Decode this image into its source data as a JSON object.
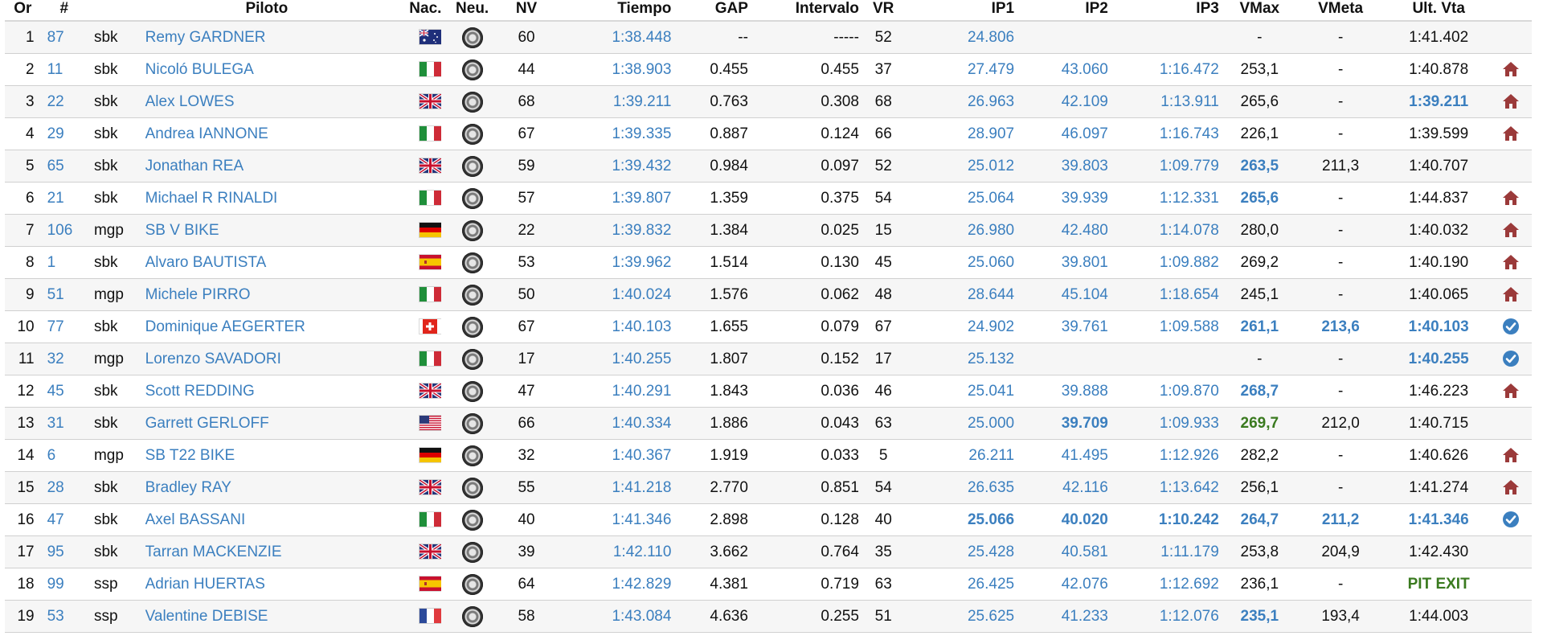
{
  "headers": {
    "pos": "Or",
    "num": "#",
    "rider": "Piloto",
    "nat": "Nac.",
    "tyre": "Neu.",
    "nv": "NV",
    "time": "Tiempo",
    "gap": "GAP",
    "interval": "Intervalo",
    "vr": "VR",
    "ip1": "IP1",
    "ip2": "IP2",
    "ip3": "IP3",
    "vmax": "VMax",
    "vmeta": "VMeta",
    "last": "Ult. Vta"
  },
  "colors": {
    "link": "#3b7fbf",
    "pit_icon": "#9b3a3a",
    "check_icon": "#3b7fbf",
    "green": "#3a7a1f"
  },
  "rows": [
    {
      "pos": "1",
      "num": "87",
      "cls": "sbk",
      "name": "Remy GARDNER",
      "flag": "AUS",
      "nv": "60",
      "time": "1:38.448",
      "gap": "--",
      "interval": "-----",
      "vr": "52",
      "ip1": "24.806",
      "ip2": "",
      "ip3": "",
      "vmax": "-",
      "vmeta": "-",
      "last": "1:41.402",
      "icon": ""
    },
    {
      "pos": "2",
      "num": "11",
      "cls": "sbk",
      "name": "Nicoló BULEGA",
      "flag": "ITA",
      "nv": "44",
      "time": "1:38.903",
      "gap": "0.455",
      "interval": "0.455",
      "vr": "37",
      "ip1": "27.479",
      "ip2": "43.060",
      "ip3": "1:16.472",
      "vmax": "253,1",
      "vmeta": "-",
      "last": "1:40.878",
      "icon": "pit"
    },
    {
      "pos": "3",
      "num": "22",
      "cls": "sbk",
      "name": "Alex LOWES",
      "flag": "GBR",
      "nv": "68",
      "time": "1:39.211",
      "gap": "0.763",
      "interval": "0.308",
      "vr": "68",
      "ip1": "26.963",
      "ip2": "42.109",
      "ip3": "1:13.911",
      "vmax": "265,6",
      "vmeta": "-",
      "last": "1:39.211",
      "icon": "pit",
      "last_style": "link-bold"
    },
    {
      "pos": "4",
      "num": "29",
      "cls": "sbk",
      "name": "Andrea IANNONE",
      "flag": "ITA",
      "nv": "67",
      "time": "1:39.335",
      "gap": "0.887",
      "interval": "0.124",
      "vr": "66",
      "ip1": "28.907",
      "ip2": "46.097",
      "ip3": "1:16.743",
      "vmax": "226,1",
      "vmeta": "-",
      "last": "1:39.599",
      "icon": "pit"
    },
    {
      "pos": "5",
      "num": "65",
      "cls": "sbk",
      "name": "Jonathan REA",
      "flag": "GBR",
      "nv": "59",
      "time": "1:39.432",
      "gap": "0.984",
      "interval": "0.097",
      "vr": "52",
      "ip1": "25.012",
      "ip2": "39.803",
      "ip3": "1:09.779",
      "vmax": "263,5",
      "vmeta": "211,3",
      "last": "1:40.707",
      "icon": "",
      "vmax_style": "link-bold"
    },
    {
      "pos": "6",
      "num": "21",
      "cls": "sbk",
      "name": "Michael R RINALDI",
      "flag": "ITA",
      "nv": "57",
      "time": "1:39.807",
      "gap": "1.359",
      "interval": "0.375",
      "vr": "54",
      "ip1": "25.064",
      "ip2": "39.939",
      "ip3": "1:12.331",
      "vmax": "265,6",
      "vmeta": "-",
      "last": "1:44.837",
      "icon": "pit",
      "vmax_style": "link-bold"
    },
    {
      "pos": "7",
      "num": "106",
      "cls": "mgp",
      "name": "SB V BIKE",
      "flag": "GER",
      "nv": "22",
      "time": "1:39.832",
      "gap": "1.384",
      "interval": "0.025",
      "vr": "15",
      "ip1": "26.980",
      "ip2": "42.480",
      "ip3": "1:14.078",
      "vmax": "280,0",
      "vmeta": "-",
      "last": "1:40.032",
      "icon": "pit"
    },
    {
      "pos": "8",
      "num": "1",
      "cls": "sbk",
      "name": "Alvaro BAUTISTA",
      "flag": "ESP",
      "nv": "53",
      "time": "1:39.962",
      "gap": "1.514",
      "interval": "0.130",
      "vr": "45",
      "ip1": "25.060",
      "ip2": "39.801",
      "ip3": "1:09.882",
      "vmax": "269,2",
      "vmeta": "-",
      "last": "1:40.190",
      "icon": "pit"
    },
    {
      "pos": "9",
      "num": "51",
      "cls": "mgp",
      "name": "Michele PIRRO",
      "flag": "ITA",
      "nv": "50",
      "time": "1:40.024",
      "gap": "1.576",
      "interval": "0.062",
      "vr": "48",
      "ip1": "28.644",
      "ip2": "45.104",
      "ip3": "1:18.654",
      "vmax": "245,1",
      "vmeta": "-",
      "last": "1:40.065",
      "icon": "pit"
    },
    {
      "pos": "10",
      "num": "77",
      "cls": "sbk",
      "name": "Dominique AEGERTER",
      "flag": "SUI",
      "nv": "67",
      "time": "1:40.103",
      "gap": "1.655",
      "interval": "0.079",
      "vr": "67",
      "ip1": "24.902",
      "ip2": "39.761",
      "ip3": "1:09.588",
      "vmax": "261,1",
      "vmeta": "213,6",
      "last": "1:40.103",
      "icon": "check",
      "vmax_style": "link-bold",
      "vmeta_style": "link-bold",
      "last_style": "link-bold"
    },
    {
      "pos": "11",
      "num": "32",
      "cls": "mgp",
      "name": "Lorenzo SAVADORI",
      "flag": "ITA",
      "nv": "17",
      "time": "1:40.255",
      "gap": "1.807",
      "interval": "0.152",
      "vr": "17",
      "ip1": "25.132",
      "ip2": "",
      "ip3": "",
      "vmax": "-",
      "vmeta": "-",
      "last": "1:40.255",
      "icon": "check",
      "last_style": "link-bold"
    },
    {
      "pos": "12",
      "num": "45",
      "cls": "sbk",
      "name": "Scott REDDING",
      "flag": "GBR",
      "nv": "47",
      "time": "1:40.291",
      "gap": "1.843",
      "interval": "0.036",
      "vr": "46",
      "ip1": "25.041",
      "ip2": "39.888",
      "ip3": "1:09.870",
      "vmax": "268,7",
      "vmeta": "-",
      "last": "1:46.223",
      "icon": "pit",
      "vmax_style": "link-bold"
    },
    {
      "pos": "13",
      "num": "31",
      "cls": "sbk",
      "name": "Garrett GERLOFF",
      "flag": "USA",
      "nv": "66",
      "time": "1:40.334",
      "gap": "1.886",
      "interval": "0.043",
      "vr": "63",
      "ip1": "25.000",
      "ip2": "39.709",
      "ip3": "1:09.933",
      "vmax": "269,7",
      "vmeta": "212,0",
      "last": "1:40.715",
      "icon": "",
      "ip2_style": "link-bold",
      "vmax_style": "green"
    },
    {
      "pos": "14",
      "num": "6",
      "cls": "mgp",
      "name": "SB T22 BIKE",
      "flag": "GER",
      "nv": "32",
      "time": "1:40.367",
      "gap": "1.919",
      "interval": "0.033",
      "vr": "5",
      "ip1": "26.211",
      "ip2": "41.495",
      "ip3": "1:12.926",
      "vmax": "282,2",
      "vmeta": "-",
      "last": "1:40.626",
      "icon": "pit"
    },
    {
      "pos": "15",
      "num": "28",
      "cls": "sbk",
      "name": "Bradley RAY",
      "flag": "GBR",
      "nv": "55",
      "time": "1:41.218",
      "gap": "2.770",
      "interval": "0.851",
      "vr": "54",
      "ip1": "26.635",
      "ip2": "42.116",
      "ip3": "1:13.642",
      "vmax": "256,1",
      "vmeta": "-",
      "last": "1:41.274",
      "icon": "pit"
    },
    {
      "pos": "16",
      "num": "47",
      "cls": "sbk",
      "name": "Axel BASSANI",
      "flag": "ITA",
      "nv": "40",
      "time": "1:41.346",
      "gap": "2.898",
      "interval": "0.128",
      "vr": "40",
      "ip1": "25.066",
      "ip2": "40.020",
      "ip3": "1:10.242",
      "vmax": "264,7",
      "vmeta": "211,2",
      "last": "1:41.346",
      "icon": "check",
      "ip1_style": "link-bold",
      "ip2_style": "link-bold",
      "ip3_style": "link-bold",
      "vmax_style": "link-bold",
      "vmeta_style": "link-bold",
      "last_style": "link-bold"
    },
    {
      "pos": "17",
      "num": "95",
      "cls": "sbk",
      "name": "Tarran MACKENZIE",
      "flag": "GBR",
      "nv": "39",
      "time": "1:42.110",
      "gap": "3.662",
      "interval": "0.764",
      "vr": "35",
      "ip1": "25.428",
      "ip2": "40.581",
      "ip3": "1:11.179",
      "vmax": "253,8",
      "vmeta": "204,9",
      "last": "1:42.430",
      "icon": ""
    },
    {
      "pos": "18",
      "num": "99",
      "cls": "ssp",
      "name": "Adrian HUERTAS",
      "flag": "ESP",
      "nv": "64",
      "time": "1:42.829",
      "gap": "4.381",
      "interval": "0.719",
      "vr": "63",
      "ip1": "26.425",
      "ip2": "42.076",
      "ip3": "1:12.692",
      "vmax": "236,1",
      "vmeta": "-",
      "last": "PIT EXIT",
      "icon": "",
      "last_style": "green"
    },
    {
      "pos": "19",
      "num": "53",
      "cls": "ssp",
      "name": "Valentine DEBISE",
      "flag": "FRA",
      "nv": "58",
      "time": "1:43.084",
      "gap": "4.636",
      "interval": "0.255",
      "vr": "51",
      "ip1": "25.625",
      "ip2": "41.233",
      "ip3": "1:12.076",
      "vmax": "235,1",
      "vmeta": "193,4",
      "last": "1:44.003",
      "icon": "",
      "vmax_style": "link-bold"
    }
  ]
}
